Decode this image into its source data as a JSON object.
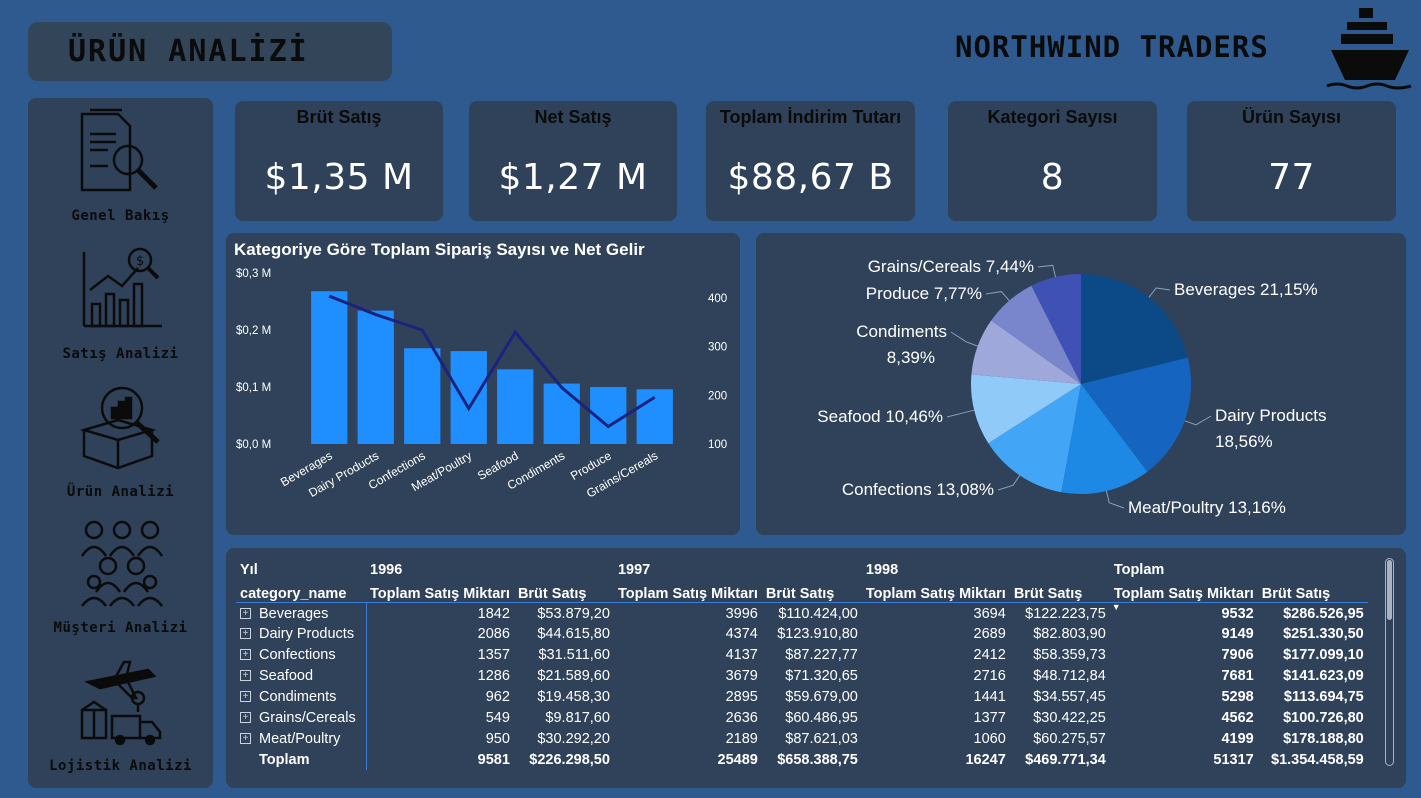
{
  "header": {
    "title": "ÜRÜN ANALİZİ",
    "brand": "NORTHWIND TRADERS"
  },
  "sidebar": {
    "items": [
      {
        "label": "Genel Bakış",
        "icon": "document-search-icon"
      },
      {
        "label": "Satış Analizi",
        "icon": "sales-chart-icon"
      },
      {
        "label": "Ürün Analizi",
        "icon": "product-box-icon"
      },
      {
        "label": "Müşteri Analizi",
        "icon": "customers-group-icon"
      },
      {
        "label": "Lojistik Analizi",
        "icon": "logistics-truck-icon"
      }
    ]
  },
  "kpis": [
    {
      "title": "Brüt Satış",
      "value": "$1,35 M"
    },
    {
      "title": "Net Satış",
      "value": "$1,27 M"
    },
    {
      "title": "Toplam İndirim Tutarı",
      "value": "$88,67 B"
    },
    {
      "title": "Kategori Sayısı",
      "value": "8"
    },
    {
      "title": "Ürün Sayısı",
      "value": "77"
    }
  ],
  "colors": {
    "background": "#2e5a8f",
    "panel": "#2f4259",
    "bar": "#1f8fff",
    "line": "#1a237e"
  },
  "chart_data": [
    {
      "type": "bar",
      "title": "Kategoriye Göre Toplam Sipariş Sayısı ve Net Gelir",
      "categories": [
        "Beverages",
        "Dairy Products",
        "Confections",
        "Meat/Poultry",
        "Seafood",
        "Condiments",
        "Produce",
        "Grains/Cereals"
      ],
      "series": [
        {
          "values": [
            0.268,
            0.234,
            0.168,
            0.163,
            0.131,
            0.106,
            0.1,
            0.096
          ],
          "axis": "left"
        },
        {
          "values": [
            404,
            366,
            334,
            173,
            330,
            216,
            136,
            196
          ],
          "axis": "right",
          "type": "line"
        }
      ],
      "y_ticks": [
        "$0,0 M",
        "$0,1 M",
        "$0,2 M",
        "$0,3 M"
      ],
      "ylim": [
        0,
        0.3
      ],
      "y2_ticks": [
        "100",
        "200",
        "300",
        "400"
      ],
      "y2lim": [
        100,
        400
      ],
      "grid": false
    },
    {
      "type": "pie",
      "slices": [
        {
          "label": "Beverages 21,15%",
          "value": 21.15,
          "color": "#0b4a86"
        },
        {
          "label": "Dairy Products 18,56%",
          "value": 18.56,
          "color": "#1565c0"
        },
        {
          "label": "Meat/Poultry 13,16%",
          "value": 13.16,
          "color": "#1e88e5"
        },
        {
          "label": "Confections 13,08%",
          "value": 13.08,
          "color": "#42a5f5"
        },
        {
          "label": "Seafood 10,46%",
          "value": 10.46,
          "color": "#90caf9"
        },
        {
          "label": "Condiments 8,39%",
          "value": 8.39,
          "color": "#9fa8da"
        },
        {
          "label": "Produce 7,77%",
          "value": 7.77,
          "color": "#7986cb"
        },
        {
          "label": "Grains/Cereals 7,44%",
          "value": 7.44,
          "color": "#3f51b5"
        }
      ]
    }
  ],
  "table": {
    "corner_top": "Yıl",
    "corner_bottom": "category_name",
    "years": [
      "1996",
      "1997",
      "1998",
      "Toplam"
    ],
    "col_qty": "Toplam Satış Miktarı",
    "col_gross": "Brüt Satış",
    "rows": [
      {
        "name": "Beverages",
        "cells": [
          "1842",
          "$53.879,20",
          "3996",
          "$110.424,00",
          "3694",
          "$122.223,75",
          "9532",
          "$286.526,95"
        ]
      },
      {
        "name": "Dairy Products",
        "cells": [
          "2086",
          "$44.615,80",
          "4374",
          "$123.910,80",
          "2689",
          "$82.803,90",
          "9149",
          "$251.330,50"
        ]
      },
      {
        "name": "Confections",
        "cells": [
          "1357",
          "$31.511,60",
          "4137",
          "$87.227,77",
          "2412",
          "$58.359,73",
          "7906",
          "$177.099,10"
        ]
      },
      {
        "name": "Seafood",
        "cells": [
          "1286",
          "$21.589,60",
          "3679",
          "$71.320,65",
          "2716",
          "$48.712,84",
          "7681",
          "$141.623,09"
        ]
      },
      {
        "name": "Condiments",
        "cells": [
          "962",
          "$19.458,30",
          "2895",
          "$59.679,00",
          "1441",
          "$34.557,45",
          "5298",
          "$113.694,75"
        ]
      },
      {
        "name": "Grains/Cereals",
        "cells": [
          "549",
          "$9.817,60",
          "2636",
          "$60.486,95",
          "1377",
          "$30.422,25",
          "4562",
          "$100.726,80"
        ]
      },
      {
        "name": "Meat/Poultry",
        "cells": [
          "950",
          "$30.292,20",
          "2189",
          "$87.621,03",
          "1060",
          "$60.275,57",
          "4199",
          "$178.188,80"
        ]
      }
    ],
    "total": {
      "name": "Toplam",
      "cells": [
        "9581",
        "$226.298,50",
        "25489",
        "$658.388,75",
        "16247",
        "$469.771,34",
        "51317",
        "$1.354.458,59"
      ]
    }
  }
}
